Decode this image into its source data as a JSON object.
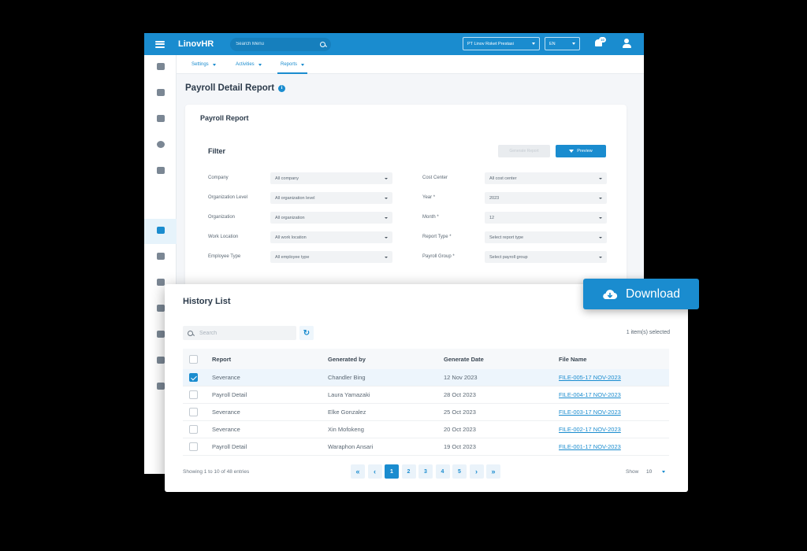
{
  "app": {
    "brand": "LinovHR",
    "search_placeholder": "Search Menu",
    "company": "PT Linov Roket Prestasi",
    "language": "EN",
    "notification_count": "10"
  },
  "subnav": {
    "tabs": [
      {
        "label": "Settings"
      },
      {
        "label": "Activities"
      },
      {
        "label": "Reports"
      }
    ]
  },
  "page": {
    "title": "Payroll Detail Report",
    "info_glyph": "i"
  },
  "report": {
    "card_title": "Payroll Report",
    "filter_title": "Filter",
    "disabled_button_label": "Generate Report",
    "preview_label": "Preview",
    "filters_left": [
      {
        "label": "Company",
        "value": "All company"
      },
      {
        "label": "Organization Level",
        "value": "All organization level"
      },
      {
        "label": "Organization",
        "value": "All organization"
      },
      {
        "label": "Work Location",
        "value": "All work location"
      },
      {
        "label": "Employee Type",
        "value": "All employee type"
      }
    ],
    "filters_right": [
      {
        "label": "Cost Center",
        "value": "All cost center"
      },
      {
        "label": "Year *",
        "value": "2023"
      },
      {
        "label": "Month *",
        "value": "12"
      },
      {
        "label": "Report Type *",
        "value": "Select report type"
      },
      {
        "label": "Payroll Group *",
        "value": "Select payroll group"
      }
    ]
  },
  "download": {
    "label": "Download"
  },
  "history": {
    "title": "History List",
    "search_placeholder": "Search",
    "refresh_glyph": "↻",
    "selected_text": "1 item(s) selected",
    "columns": [
      "Report",
      "Generated by",
      "Generate Date",
      "File Name"
    ],
    "rows": [
      {
        "report": "Severance",
        "generated_by": "Chandler Bing",
        "date": "12 Nov 2023",
        "file": "FILE-005-17 NOV-2023",
        "checked": true
      },
      {
        "report": "Payroll Detail",
        "generated_by": "Laura Yamazaki",
        "date": "28 Oct 2023",
        "file": "FILE-004-17 NOV-2023",
        "checked": false
      },
      {
        "report": "Severance",
        "generated_by": "Elke Gonzalez",
        "date": "25 Oct 2023",
        "file": "FILE-003-17 NOV-2023",
        "checked": false
      },
      {
        "report": "Severance",
        "generated_by": "Xin Mofokeng",
        "date": "20 Oct 2023",
        "file": "FILE-002-17 NOV-2023",
        "checked": false
      },
      {
        "report": "Payroll Detail",
        "generated_by": "Waraphon Ansari",
        "date": "19 Oct 2023",
        "file": "FILE-001-17 NOV-2023",
        "checked": false
      }
    ],
    "showing_text": "Showing 1 to 10 of 48 entries",
    "pages": [
      "1",
      "2",
      "3",
      "4",
      "5"
    ],
    "nav": {
      "first": "«",
      "prev": "‹",
      "next": "›",
      "last": "»"
    },
    "show_label": "Show",
    "page_size": "10"
  },
  "colors": {
    "primary": "#1a8ccf",
    "background": "#000000"
  }
}
